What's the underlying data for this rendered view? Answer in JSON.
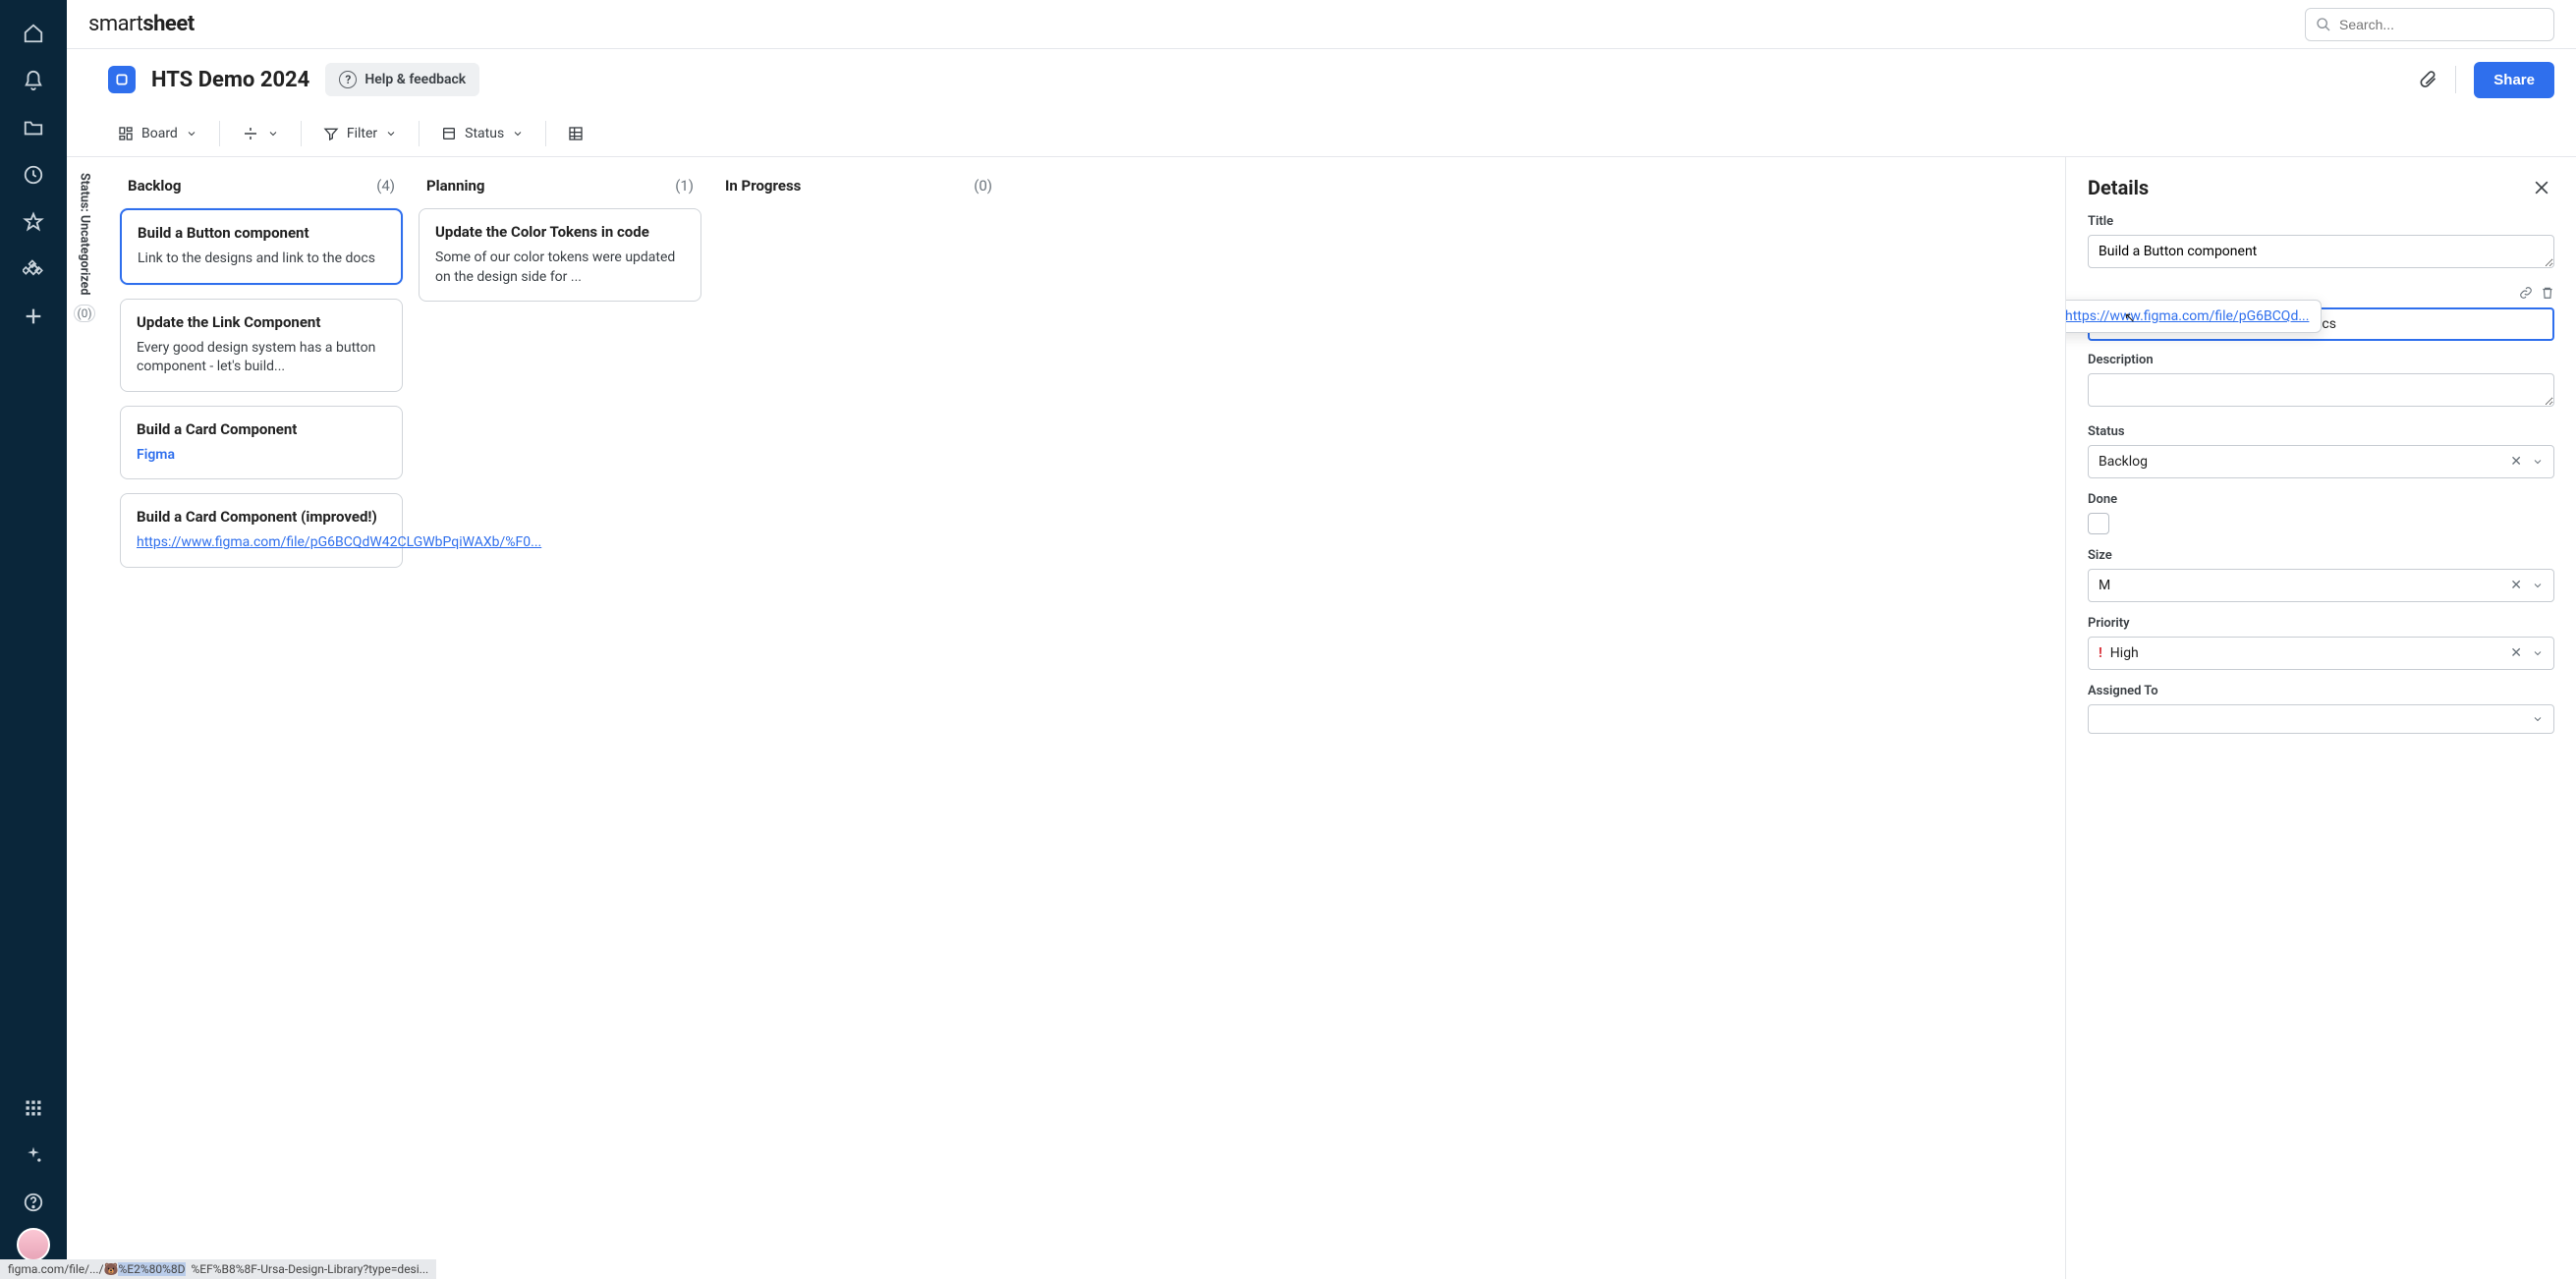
{
  "brand": {
    "part1": "smart",
    "part2": "sheet"
  },
  "search": {
    "placeholder": "Search..."
  },
  "workspace": {
    "title": "HTS Demo 2024",
    "help_label": "Help & feedback",
    "share_label": "Share"
  },
  "toolbar": {
    "view": "Board",
    "filter": "Filter",
    "group": "Status"
  },
  "lane": {
    "label": "Status: Uncategorized",
    "count": "(0)"
  },
  "columns": [
    {
      "name": "Backlog",
      "count": "(4)"
    },
    {
      "name": "Planning",
      "count": "(1)"
    },
    {
      "name": "In Progress",
      "count": "(0)"
    }
  ],
  "cards": {
    "backlog": [
      {
        "title": "Build a Button component",
        "body": "Link to the designs and link to the docs",
        "selected": true
      },
      {
        "title": "Update the Link Component",
        "body": "Every good design system has a button component - let's build..."
      },
      {
        "title": "Build a Card Component",
        "body": "Figma",
        "body_is_link": true
      },
      {
        "title": "Build a Card Component (improved!)",
        "body": "https://www.figma.com/file/pG6BCQdW42CLGWbPqiWAXb/%F0...",
        "body_is_url": true
      }
    ],
    "planning": [
      {
        "title": "Update the Color Tokens in code",
        "body": "Some of our color tokens were updated on the design side for ..."
      }
    ]
  },
  "details": {
    "heading": "Details",
    "labels": {
      "title": "Title",
      "description": "Description",
      "status": "Status",
      "done": "Done",
      "size": "Size",
      "priority": "Priority",
      "assigned": "Assigned To"
    },
    "title_value": "Build a Button component",
    "link_url_display": "https://www.figma.com/file/pG6BCQd...",
    "rich_prefix": "Link to the ",
    "rich_link": "designs",
    "rich_suffix": " and link to the docs",
    "status_value": "Backlog",
    "size_value": "M",
    "priority_value": "High",
    "priority_mark": "!"
  },
  "statusbar": {
    "a": "figma.com/file/.../",
    "emoji": "🐻",
    "b": "%E2%80%8D",
    "c": "%EF%B8%8F-Ursa-Design-Library?type=desi..."
  }
}
